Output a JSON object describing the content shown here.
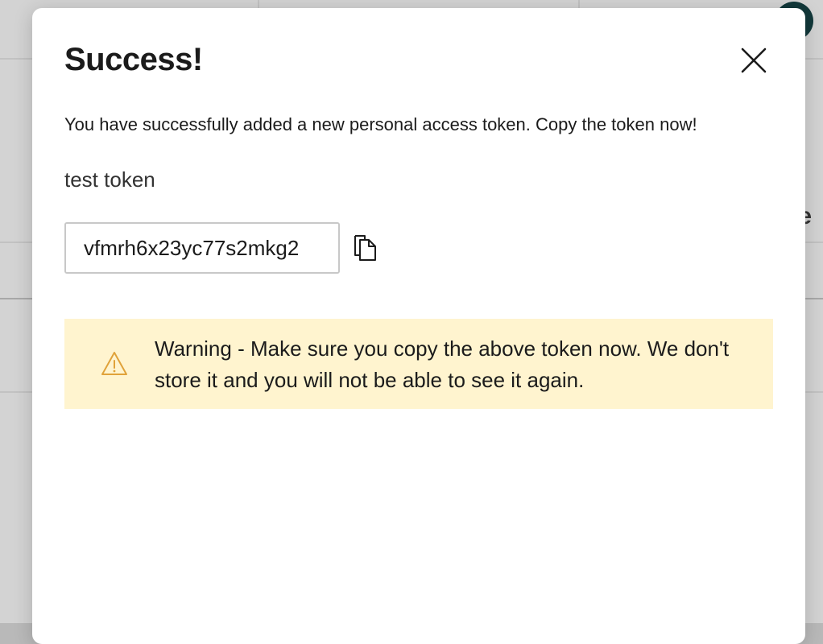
{
  "modal": {
    "title": "Success!",
    "message": "You have successfully added a new personal access token. Copy the token now!",
    "token_name": "test token",
    "token_value": "vfmrh6x23yc77s2mkg2",
    "warning": "Warning - Make sure you copy the above token now. We don't store it and you will not be able to see it again."
  },
  "icons": {
    "close": "close-icon",
    "copy": "copy-icon",
    "warning": "warning-icon"
  },
  "colors": {
    "warning_background": "#fff4cf",
    "warning_icon": "#e0a23a",
    "avatar": "#12383a"
  }
}
